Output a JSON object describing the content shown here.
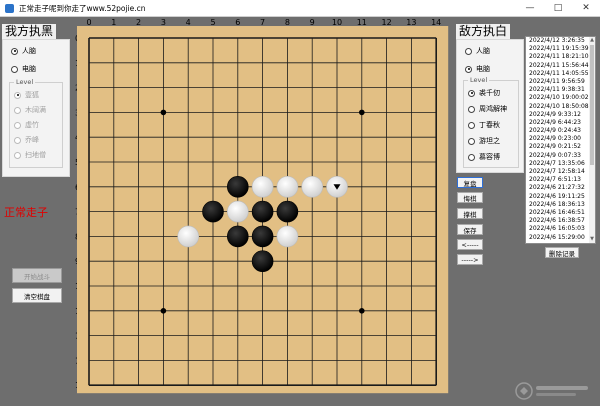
{
  "window": {
    "title": "正常走子呢到你走了www.52pojie.cn",
    "minimize": "—",
    "maximize": "□",
    "close": "✕"
  },
  "left": {
    "title": "我方执黑",
    "options": [
      {
        "label": "人脑",
        "selected": true
      },
      {
        "label": "电脑",
        "selected": false
      }
    ],
    "level_legend": "Level",
    "levels": [
      "壹狐",
      "木阔满",
      "虚竹",
      "乔峰",
      "扫地僧"
    ],
    "status_text": "正常走子",
    "start_button": "开始战斗",
    "clear_button": "清空棋盘"
  },
  "right": {
    "title": "敌方执白",
    "options": [
      {
        "label": "人脑",
        "selected": false
      },
      {
        "label": "电脑",
        "selected": true
      }
    ],
    "level_legend": "Level",
    "levels": [
      {
        "label": "裘千仞",
        "selected": true
      },
      {
        "label": "周鸿解神",
        "selected": false
      },
      {
        "label": "丁春秋",
        "selected": false
      },
      {
        "label": "游坦之",
        "selected": false
      },
      {
        "label": "慕容博",
        "selected": false
      }
    ],
    "buttons": [
      "复盘",
      "悔棋",
      "撑棋",
      "保存",
      "<-----",
      "----->"
    ],
    "delete_button": "删除记录",
    "records": [
      "2022/4/12 3:26:35",
      "2022/4/11 19:15:39",
      "2022/4/11 18:21:10",
      "2022/4/11 15:56:44",
      "2022/4/11 14:05:55",
      "2022/4/11 9:56:59",
      "2022/4/11 9:38:31",
      "2022/4/10 19:00:02",
      "2022/4/10 18:50:08",
      "2022/4/9 9:33:12",
      "2022/4/9 6:44:23",
      "2022/4/9 0:24:43",
      "2022/4/9 0:23:00",
      "2022/4/9 0:21:52",
      "2022/4/9 0:07:33",
      "2022/4/7 13:35:06",
      "2022/4/7 12:58:14",
      "2022/4/7 6:51:13",
      "2022/4/6 21:27:32",
      "2022/4/6 19:11:25",
      "2022/4/6 18:36:13",
      "2022/4/6 16:46:51",
      "2022/4/6 16:38:57",
      "2022/4/6 16:05:03",
      "2022/4/6 15:29:00"
    ]
  },
  "board": {
    "size": 15,
    "col_labels": [
      "0",
      "1",
      "2",
      "3",
      "4",
      "5",
      "6",
      "7",
      "8",
      "9",
      "10",
      "11",
      "12",
      "13",
      "14"
    ],
    "row_labels": [
      "0",
      "1",
      "2",
      "3",
      "4",
      "5",
      "6",
      "7",
      "8",
      "9",
      "10",
      "11",
      "12",
      "13",
      "14"
    ],
    "star_points": [
      [
        3,
        3
      ],
      [
        11,
        3
      ],
      [
        3,
        11
      ],
      [
        11,
        11
      ]
    ],
    "stones": [
      {
        "col": 6,
        "row": 6,
        "color": "black"
      },
      {
        "col": 7,
        "row": 6,
        "color": "white"
      },
      {
        "col": 8,
        "row": 6,
        "color": "white"
      },
      {
        "col": 9,
        "row": 6,
        "color": "white"
      },
      {
        "col": 10,
        "row": 6,
        "color": "white",
        "last": true
      },
      {
        "col": 5,
        "row": 7,
        "color": "black"
      },
      {
        "col": 6,
        "row": 7,
        "color": "white"
      },
      {
        "col": 7,
        "row": 7,
        "color": "black"
      },
      {
        "col": 8,
        "row": 7,
        "color": "black"
      },
      {
        "col": 4,
        "row": 8,
        "color": "white"
      },
      {
        "col": 6,
        "row": 8,
        "color": "black"
      },
      {
        "col": 7,
        "row": 8,
        "color": "black"
      },
      {
        "col": 8,
        "row": 8,
        "color": "white"
      },
      {
        "col": 7,
        "row": 9,
        "color": "black"
      }
    ],
    "colors": {
      "wood": "#e2bf84",
      "line": "#1a1a1a"
    }
  }
}
